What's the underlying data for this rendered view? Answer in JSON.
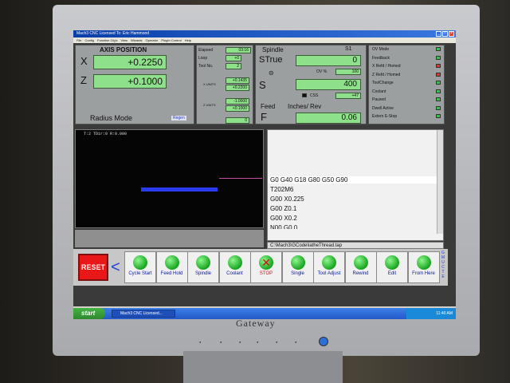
{
  "window": {
    "title": "Mach3 CNC  Licensed To: Eric Hammond",
    "controls": [
      "_",
      "□",
      "×"
    ]
  },
  "menu": [
    "File",
    "Config",
    "Function Cfg's",
    "View",
    "Wizards",
    "Operator",
    "PlugIn Control",
    "Help"
  ],
  "axis_panel": {
    "title": "AXIS POSITION",
    "x_label": "X",
    "x_value": "+0.2250",
    "z_label": "Z",
    "z_value": "+0.1000",
    "mode": "Radius Mode",
    "regen": "Regen"
  },
  "info_panel": {
    "elapsed_label": "Elapsed",
    "elapsed_value": "03:16",
    "loop_label": "Loop",
    "loop_value": "+0",
    "toolno_label": "Tool No.",
    "toolno_value": "2",
    "xunits_label": "X UNITS",
    "xunits_values": [
      "+0.1435",
      "+0.2200"
    ],
    "zunits_label": "Z UNITS",
    "zunits_values": [
      "-1.0000",
      "+0.1000"
    ],
    "bottom_value": "0"
  },
  "spindle_panel": {
    "title": "Spindle",
    "s1": "S1",
    "strue_label": "STrue",
    "strue_value": "0",
    "ov_label": "OV %",
    "ov_value": "100",
    "s_label": "S",
    "s_value": "400",
    "css_label": "CSS",
    "css_value": "+47",
    "feed_label": "Feed",
    "feed_units": "Inches/ Rev",
    "f_label": "F",
    "f_value": "0.06"
  },
  "status_leds": [
    {
      "label": "OV Mode",
      "color": "#3ac24a"
    },
    {
      "label": "Feedback",
      "color": "#3ac24a"
    },
    {
      "label": "X Refd / Homed",
      "color": "#d23a2a"
    },
    {
      "label": "Z Refd / Homed",
      "color": "#d23a2a"
    },
    {
      "label": "ToolChange",
      "color": "#3ac24a"
    },
    {
      "label": "Coolant",
      "color": "#3ac24a"
    },
    {
      "label": "Paused",
      "color": "#3ac24a"
    },
    {
      "label": "Dwell Active",
      "color": "#3ac24a"
    },
    {
      "label": "Extern E-Stop",
      "color": "#3ac24a"
    }
  ],
  "toolpath": {
    "header": "T:2 TDir:0 R:0.000"
  },
  "gcode": {
    "lines": [
      "G0 G40 G18 G80 G50 G90",
      "T202M6",
      "G00  X0.225",
      "G00 Z0.1",
      "G00 X0.2",
      "N00 G0 0"
    ],
    "file": "C:\\Mach3\\GCode\\latheThread.tap"
  },
  "buttons": {
    "reset": "RESET",
    "prev_arrow": "<",
    "items": [
      {
        "label": "Cycle Start",
        "red": false
      },
      {
        "label": "Feed Hold",
        "red": false
      },
      {
        "label": "Spindle",
        "red": false
      },
      {
        "label": "Coolant",
        "red": false
      },
      {
        "label": "STOP",
        "red": true
      },
      {
        "label": "Single",
        "red": false
      },
      {
        "label": "Tool Adjust",
        "red": false
      },
      {
        "label": "Rewind",
        "red": false
      },
      {
        "label": "Edit",
        "red": false
      },
      {
        "label": "From Here",
        "red": false
      }
    ],
    "side_letters": [
      "G",
      "M",
      "U",
      "C",
      "T",
      "E"
    ]
  },
  "taskbar": {
    "start": "start",
    "task": "Mach3 CNC Licensed...",
    "clock": "11:40 AM"
  },
  "monitor": {
    "brand": "Gateway"
  }
}
